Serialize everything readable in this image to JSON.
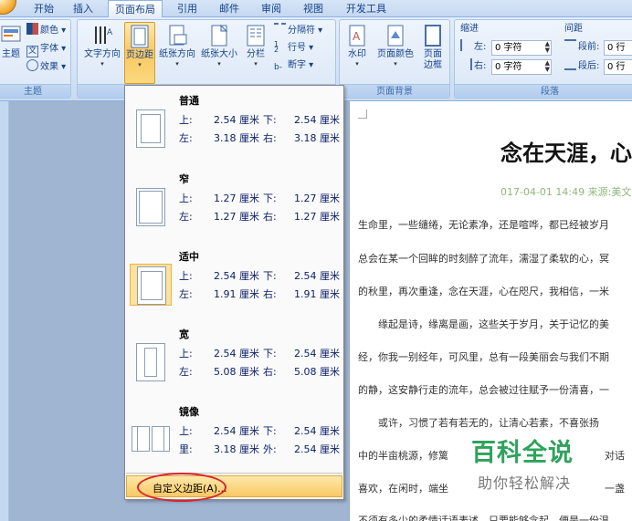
{
  "tabs": [
    "开始",
    "插入",
    "页面布局",
    "引用",
    "邮件",
    "审阅",
    "视图",
    "开发工具"
  ],
  "active_tab": "页面布局",
  "ribbon": {
    "theme_group": {
      "label": "主题",
      "theme_btn": "主题",
      "colors": "颜色",
      "fonts": "字体",
      "effects": "效果"
    },
    "page_setup_group": {
      "label": "",
      "text_direction": "文字方向",
      "margins": "页边距",
      "orientation": "纸张方向",
      "size": "纸张大小",
      "columns": "分栏",
      "breaks": "分隔符",
      "line_numbers": "行号",
      "hyphenation": "断字"
    },
    "page_background_group": {
      "label": "页面背景",
      "watermark": "水印",
      "page_color": "页面颜色",
      "page_border_1": "页面",
      "page_border_2": "边框"
    },
    "paragraph_group": {
      "label": "段落",
      "indent_title": "缩进",
      "spacing_title": "间距",
      "indent_left_label": "左:",
      "indent_left_value": "0 字符",
      "indent_right_label": "右:",
      "indent_right_value": "0 字符",
      "spacing_before_label": "段前:",
      "spacing_before_value": "0 行",
      "spacing_after_label": "段后:",
      "spacing_after_value": "0 行"
    }
  },
  "margins_menu": {
    "items": [
      {
        "name": "普通",
        "r1": [
          "上:",
          "2.54 厘米",
          "下:",
          "2.54 厘米"
        ],
        "r2": [
          "左:",
          "3.18 厘米",
          "右:",
          "3.18 厘米"
        ]
      },
      {
        "name": "窄",
        "r1": [
          "上:",
          "1.27 厘米",
          "下:",
          "1.27 厘米"
        ],
        "r2": [
          "左:",
          "1.27 厘米",
          "右:",
          "1.27 厘米"
        ]
      },
      {
        "name": "适中",
        "r1": [
          "上:",
          "2.54 厘米",
          "下:",
          "2.54 厘米"
        ],
        "r2": [
          "左:",
          "1.91 厘米",
          "右:",
          "1.91 厘米"
        ]
      },
      {
        "name": "宽",
        "r1": [
          "上:",
          "2.54 厘米",
          "下:",
          "2.54 厘米"
        ],
        "r2": [
          "左:",
          "5.08 厘米",
          "右:",
          "5.08 厘米"
        ]
      },
      {
        "name": "镜像",
        "r1": [
          "上:",
          "2.54 厘米",
          "下:",
          "2.54 厘米"
        ],
        "r2": [
          "里:",
          "3.18 厘米",
          "外:",
          "2.54 厘米"
        ]
      }
    ],
    "selected": "适中",
    "custom": "自定义边距(A)..."
  },
  "document": {
    "title": "念在天涯，心",
    "meta": "017-04-01 14:49 来源:美文",
    "lines": [
      "生命里，一些缱绻，无论素净，还是喧哗，都已经被岁月",
      "总会在某一个回眸的时刻醉了流年，濡湿了柔软的心，冥",
      "的秋里，再次重逢，念在天涯，心在咫尺，我相信，一米",
      "　　缘起是诗，缘离是画，这些关于岁月，关于记忆的美",
      "经，你我一别经年，可风里，总有一段美丽会与我们不期",
      "的静，这安静行走的流年，总会被过往赋予一份清喜，一",
      "　　或许，习惯了若有若无的，让清心若素，不喜张扬",
      "中的半亩桃源，修篱",
      "喜欢，在闲时，端坐",
      "不须有多少的柔情话语表述，只要能够念起，便是一份温"
    ],
    "line_tail_7": "对话",
    "line_tail_8": "一盏"
  },
  "watermark": {
    "logo": "百科全说",
    "slogan": "助你轻松解决"
  },
  "colors": {
    "ribbon_text": "#15428b",
    "active_highlight": "#f9c863",
    "oval": "#d9232e",
    "watermark_green": "#2ea35c"
  }
}
